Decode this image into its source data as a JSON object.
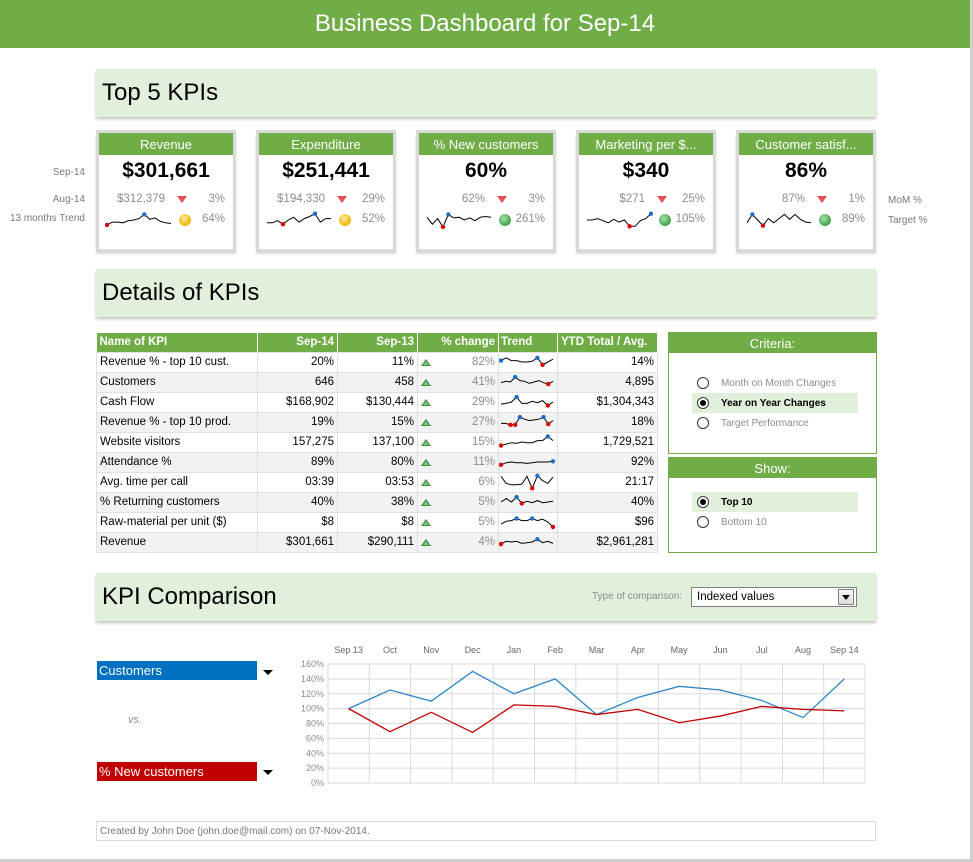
{
  "header": {
    "title": "Business Dashboard for Sep-14"
  },
  "sections": {
    "top5": "Top 5 KPIs",
    "details": "Details of KPIs",
    "comparison": "KPI Comparison"
  },
  "kpi_row_labels": {
    "current": "Sep-14",
    "previous": "Aug-14",
    "trend": "13 months Trend"
  },
  "kpi_side_labels": {
    "mom": "MoM %",
    "target": "Target %"
  },
  "kpis": [
    {
      "name": "Revenue",
      "value": "$301,661",
      "previous": "$312,379",
      "mom_change": "3%",
      "mom_direction": "down",
      "target_status": "amber",
      "target_pct": "64%",
      "trend": [
        0.15,
        0.35,
        0.35,
        0.3,
        0.45,
        0.5,
        0.6,
        0.9,
        0.55,
        0.65,
        0.4,
        0.3,
        0.25
      ],
      "trend_min_index": 0,
      "trend_max_index": 7
    },
    {
      "name": "Expenditure",
      "value": "$251,441",
      "previous": "$194,330",
      "mom_change": "29%",
      "mom_direction": "down",
      "target_status": "amber",
      "target_pct": "52%",
      "trend": [
        0.3,
        0.3,
        0.45,
        0.2,
        0.5,
        0.7,
        0.35,
        0.6,
        0.75,
        0.95,
        0.35,
        0.6,
        0.6
      ],
      "trend_min_index": 3,
      "trend_max_index": 9
    },
    {
      "name": "% New customers",
      "value": "60%",
      "previous": "62%",
      "mom_change": "3%",
      "mom_direction": "down",
      "target_status": "green",
      "target_pct": "261%",
      "trend": [
        0.7,
        0.2,
        0.6,
        0.0,
        0.9,
        0.65,
        0.7,
        0.5,
        0.65,
        0.45,
        0.7,
        0.75,
        0.7
      ],
      "trend_min_index": 3,
      "trend_max_index": 4
    },
    {
      "name": "Marketing per $...",
      "value": "$340",
      "previous": "$271",
      "mom_change": "25%",
      "mom_direction": "down",
      "target_status": "green",
      "target_pct": "105%",
      "trend": [
        0.5,
        0.5,
        0.6,
        0.45,
        0.3,
        0.55,
        0.35,
        0.5,
        0.05,
        0.05,
        0.45,
        0.6,
        0.95
      ],
      "trend_min_index": 8,
      "trend_max_index": 12
    },
    {
      "name": "Customer satisf...",
      "value": "86%",
      "previous": "87%",
      "mom_change": "1%",
      "mom_direction": "down",
      "target_status": "green",
      "target_pct": "89%",
      "trend": [
        0.3,
        0.9,
        0.5,
        0.1,
        0.6,
        0.3,
        0.6,
        0.9,
        0.55,
        0.9,
        0.55,
        0.35,
        0.3
      ],
      "trend_min_index": 3,
      "trend_max_index": 1
    }
  ],
  "details_table": {
    "columns": [
      "Name of KPI",
      "Sep-14",
      "Sep-13",
      "% change",
      "Trend",
      "YTD Total / Avg."
    ],
    "rows": [
      {
        "name": "Revenue % - top 10 cust.",
        "current": "20%",
        "previous": "11%",
        "change": "82%",
        "ytd": "14%",
        "trend": [
          0.6,
          0.8,
          0.6,
          0.6,
          0.5,
          0.5,
          0.55,
          0.8,
          0.3,
          0.5,
          0.7
        ],
        "min": 8,
        "max": 7,
        "max2": 0
      },
      {
        "name": "Customers",
        "current": "646",
        "previous": "458",
        "change": "41%",
        "ytd": "4,895",
        "trend": [
          0.45,
          0.55,
          0.5,
          0.85,
          0.6,
          0.55,
          0.4,
          0.5,
          0.6,
          0.45,
          0.35,
          0.55
        ],
        "min": 10,
        "max": 3
      },
      {
        "name": "Cash Flow",
        "current": "$168,902",
        "previous": "$130,444",
        "change": "29%",
        "ytd": "$1,304,343",
        "trend": [
          0.35,
          0.4,
          0.5,
          0.85,
          0.4,
          0.4,
          0.55,
          0.45,
          0.6,
          0.25,
          0.5
        ],
        "min": 9,
        "max": 3
      },
      {
        "name": "Revenue % - top 10 prod.",
        "current": "19%",
        "previous": "15%",
        "change": "27%",
        "ytd": "18%",
        "trend": [
          0.4,
          0.4,
          0.3,
          0.3,
          0.85,
          0.7,
          0.6,
          0.65,
          0.7,
          0.85,
          0.35,
          0.6
        ],
        "min": 2,
        "min2": 3,
        "min3": 10,
        "max": 4,
        "max2": 9
      },
      {
        "name": "Website visitors",
        "current": "157,275",
        "previous": "137,100",
        "change": "15%",
        "ytd": "1,729,521",
        "trend": [
          0.25,
          0.35,
          0.45,
          0.4,
          0.5,
          0.45,
          0.45,
          0.6,
          0.6,
          0.9,
          0.6
        ],
        "min": 0,
        "max": 9
      },
      {
        "name": "Attendance %",
        "current": "89%",
        "previous": "80%",
        "change": "11%",
        "ytd": "92%",
        "trend": [
          0.3,
          0.45,
          0.5,
          0.45,
          0.45,
          0.4,
          0.45,
          0.5,
          0.5,
          0.5,
          0.55
        ],
        "min": 0,
        "max": 10
      },
      {
        "name": "Avg. time per call",
        "current": "03:39",
        "previous": "03:53",
        "change": "6%",
        "ytd": "21:17",
        "trend": [
          0.9,
          0.4,
          0.3,
          0.3,
          0.35,
          0.9,
          0.05,
          0.95,
          0.6,
          0.4,
          0.85
        ],
        "min": 6,
        "max": 7
      },
      {
        "name": "% Returning customers",
        "current": "40%",
        "previous": "38%",
        "change": "5%",
        "ytd": "40%",
        "trend": [
          0.5,
          0.75,
          0.5,
          0.85,
          0.4,
          0.55,
          0.45,
          0.6,
          0.45,
          0.5,
          0.55
        ],
        "min": 4,
        "max": 3
      },
      {
        "name": "Raw-material per unit ($)",
        "current": "$8",
        "previous": "$8",
        "change": "5%",
        "ytd": "$96",
        "trend": [
          0.35,
          0.55,
          0.6,
          0.75,
          0.6,
          0.6,
          0.75,
          0.6,
          0.7,
          0.5,
          0.15
        ],
        "min": 10,
        "max": 3,
        "max2": 6
      },
      {
        "name": "Revenue",
        "current": "$301,661",
        "previous": "$290,111",
        "change": "4%",
        "ytd": "$2,961,281",
        "trend": [
          0.35,
          0.55,
          0.5,
          0.55,
          0.4,
          0.45,
          0.5,
          0.7,
          0.45,
          0.55,
          0.4
        ],
        "min": 0,
        "max": 7
      }
    ]
  },
  "criteria_panel": {
    "title": "Criteria:",
    "options": [
      {
        "label": "Month on Month Changes",
        "selected": false
      },
      {
        "label": "Year on Year Changes",
        "selected": true
      },
      {
        "label": "Target Performance",
        "selected": false
      }
    ]
  },
  "show_panel": {
    "title": "Show:",
    "options": [
      {
        "label": "Top 10",
        "selected": true
      },
      {
        "label": "Bottom 10",
        "selected": false
      }
    ]
  },
  "comparison": {
    "type_label": "Type of comparison:",
    "type_value": "Indexed values",
    "series_a": "Customers",
    "vs_label": "vs.",
    "series_b": "% New customers",
    "colors": {
      "series_a": "#2e86c9",
      "series_b": "#c00000",
      "series_a_fill": "#0070c0",
      "series_b_fill": "#c00000"
    }
  },
  "chart_data": {
    "type": "line",
    "title": "",
    "xlabel": "",
    "ylabel": "",
    "categories": [
      "Sep 13",
      "Oct",
      "Nov",
      "Dec",
      "Jan",
      "Feb",
      "Mar",
      "Apr",
      "May",
      "Jun",
      "Jul",
      "Aug",
      "Sep 14"
    ],
    "y_ticks": [
      "0%",
      "20%",
      "40%",
      "60%",
      "80%",
      "100%",
      "120%",
      "140%",
      "160%"
    ],
    "ylim": [
      0,
      160
    ],
    "grid": true,
    "x_axis_position": "top",
    "series": [
      {
        "name": "Customers",
        "color": "#2e86c9",
        "values": [
          100,
          125,
          110,
          150,
          120,
          140,
          92,
          115,
          130,
          125,
          111,
          88,
          140
        ]
      },
      {
        "name": "% New customers",
        "color": "#c00000",
        "values": [
          100,
          69,
          95,
          68,
          105,
          103,
          92,
          99,
          81,
          90,
          103,
          99,
          97
        ]
      }
    ]
  },
  "footer": {
    "text": "Created by John Doe (john.doe@mail.com) on 07-Nov-2014."
  }
}
